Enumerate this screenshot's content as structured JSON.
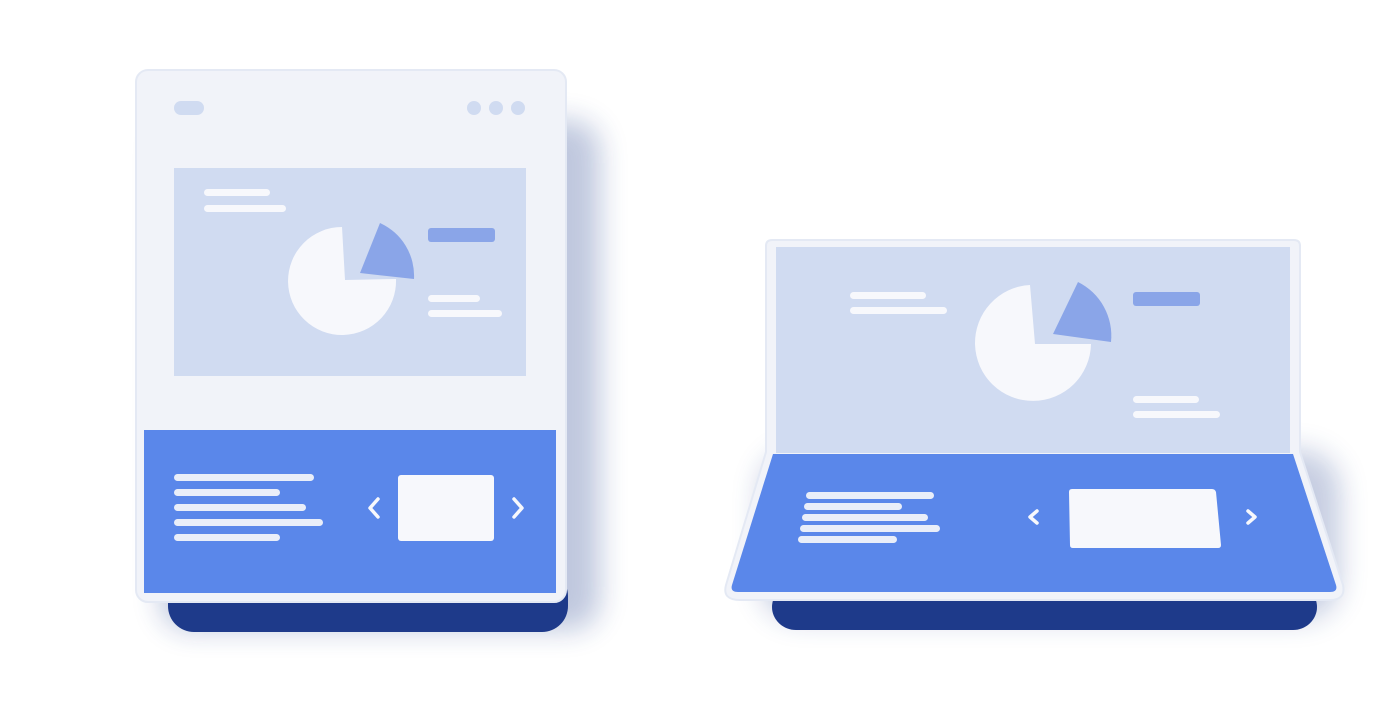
{
  "colors": {
    "background": "#ffffff",
    "frame": "#f1f3f9",
    "panel": "#d0dbf1",
    "accent": "#5a87ea",
    "accent_dark": "#1e3a8a",
    "pale": "#f7f8fc",
    "mid_blue": "#8aa5e8",
    "line_light": "#e9eef9"
  },
  "icons": {
    "prev": "chevron-left-icon",
    "next": "chevron-right-icon",
    "chart": "pie-chart-icon",
    "menu": "three-dots-icon"
  }
}
